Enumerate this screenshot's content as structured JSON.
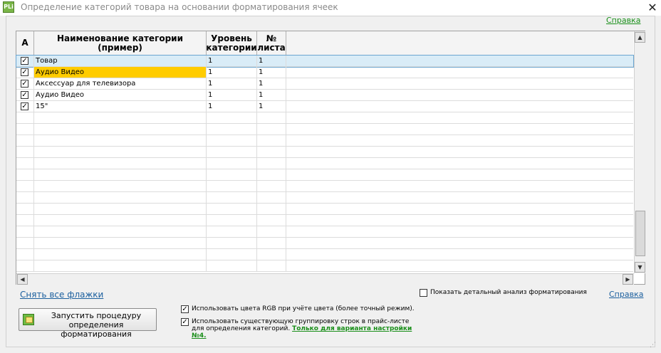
{
  "window": {
    "title": "Определение категорий товара на основании форматирования ячеек",
    "icon_text": "PLi",
    "close_symbol": "✕",
    "help_top": "Справка"
  },
  "grid": {
    "columns": [
      {
        "label": "A"
      },
      {
        "label": "Наименование категории (пример)"
      },
      {
        "label": "Уровень категории"
      },
      {
        "label": "№ листа"
      },
      {
        "label": ""
      }
    ],
    "rows": [
      {
        "checked": true,
        "name": "Товар",
        "level": "1",
        "sheet": "1",
        "selected": true,
        "highlight": false
      },
      {
        "checked": true,
        "name": "Аудио Видео",
        "level": "1",
        "sheet": "1",
        "selected": false,
        "highlight": true
      },
      {
        "checked": true,
        "name": "Аксессуар для телевизора",
        "level": "1",
        "sheet": "1",
        "selected": false,
        "highlight": false
      },
      {
        "checked": true,
        "name": "Аудио Видео",
        "level": "1",
        "sheet": "1",
        "selected": false,
        "highlight": false
      },
      {
        "checked": true,
        "name": "15\"",
        "level": "1",
        "sheet": "1",
        "selected": false,
        "highlight": false
      }
    ],
    "colors": {
      "selected_row": "#d9ecf7",
      "highlight_cell": "#ffcc00"
    }
  },
  "bottom": {
    "uncheck_all": "Снять все флажки",
    "show_analysis": "Показать детальный анализ форматирования",
    "show_analysis_checked": false,
    "help_bottom": "Справка",
    "run_button": "Запустить процедуру определения форматирования",
    "option_rgb": "Использовать цвета RGB при учёте цвета (более точный режим).",
    "option_rgb_checked": true,
    "option_grouping": "Использовать существующую группировку строк в прайс-листе для определения категорий.",
    "option_grouping_checked": true,
    "variant_link": "Только для варианта настройки №4."
  }
}
